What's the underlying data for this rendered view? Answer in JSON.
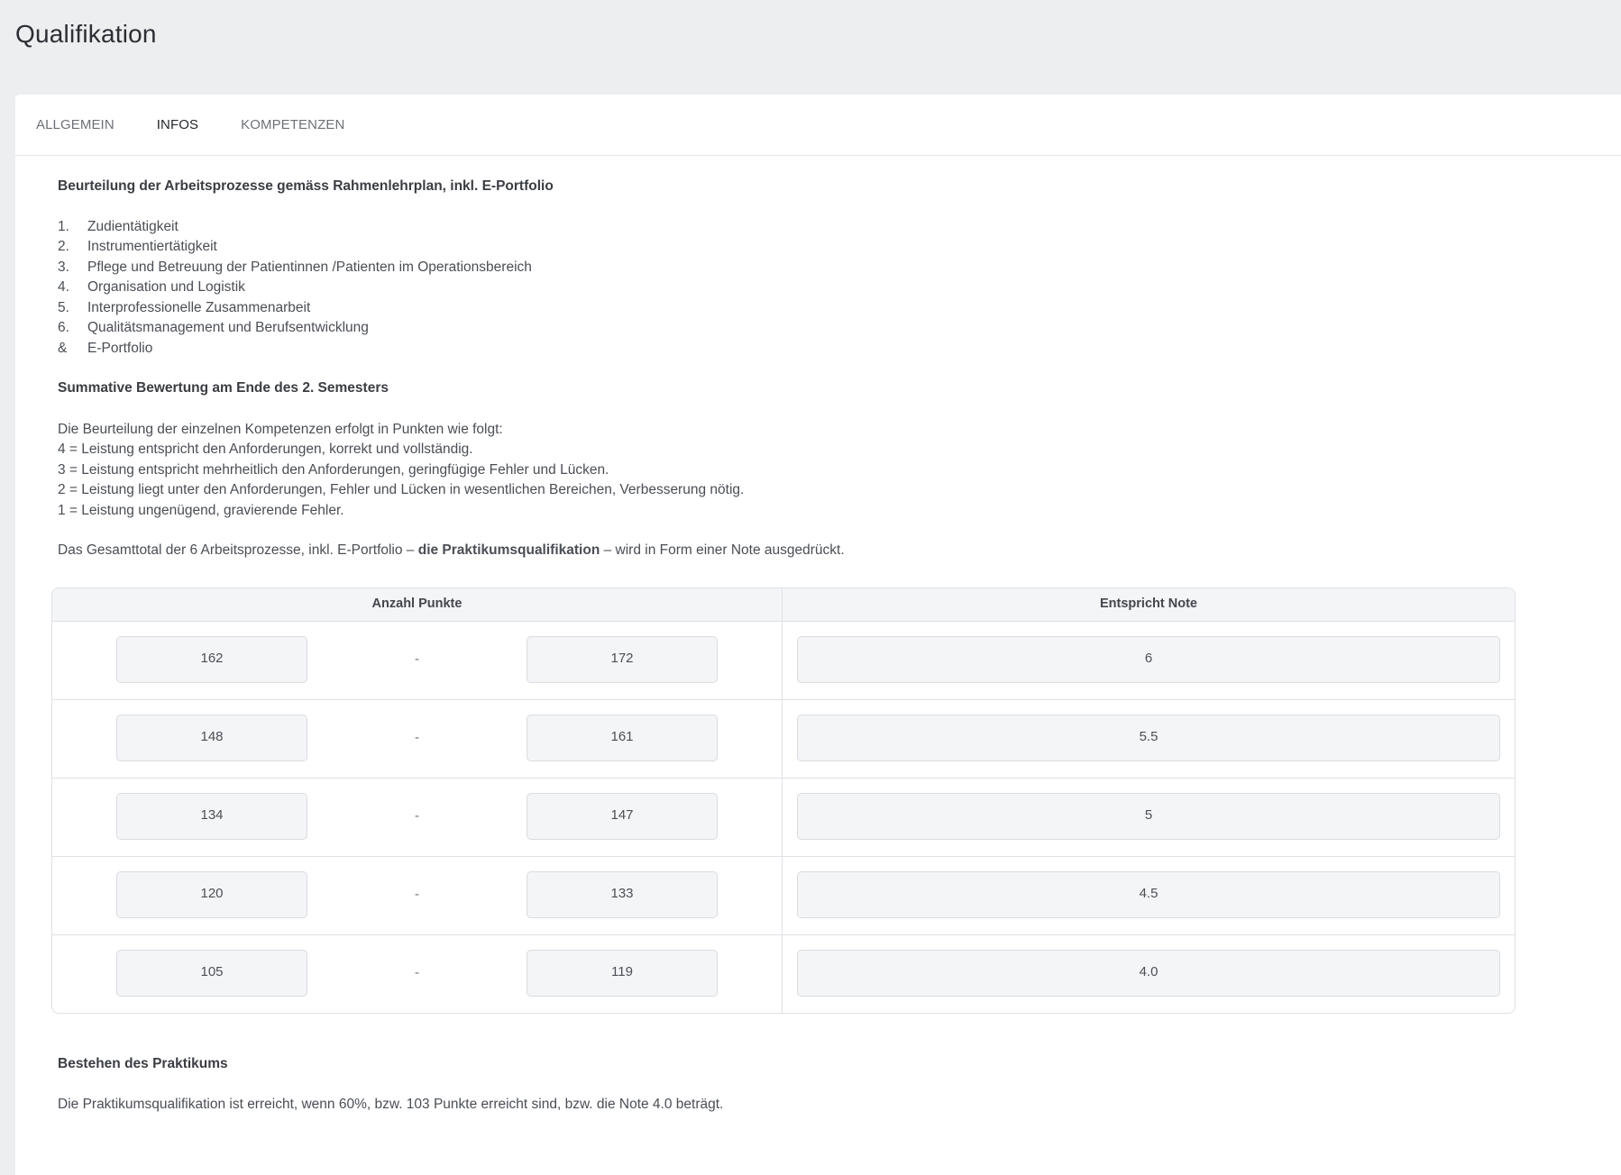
{
  "page": {
    "title": "Qualifikation"
  },
  "tabs": [
    {
      "label": "ALLGEMEIN",
      "active": false
    },
    {
      "label": "INFOS",
      "active": true
    },
    {
      "label": "KOMPETENZEN",
      "active": false
    }
  ],
  "assessment": {
    "heading": "Beurteilung der Arbeitsprozesse gemäss Rahmenlehrplan, inkl. E-Portfolio",
    "items": [
      {
        "num": "1.",
        "label": "Zudientätigkeit"
      },
      {
        "num": "2.",
        "label": "Instrumentiertätigkeit"
      },
      {
        "num": "3.",
        "label": "Pflege und Betreuung der Patientinnen /Patienten im Operationsbereich"
      },
      {
        "num": "4.",
        "label": "Organisation und Logistik"
      },
      {
        "num": "5.",
        "label": "Interprofessionelle Zusammenarbeit"
      },
      {
        "num": "6.",
        "label": "Qualitätsmanagement und Berufsentwicklung"
      },
      {
        "num": "&",
        "label": "E-Portfolio"
      }
    ]
  },
  "summative": {
    "heading": "Summative Bewertung am Ende des 2. Semesters",
    "intro": "Die Beurteilung der einzelnen Kompetenzen erfolgt in Punkten wie folgt:",
    "scale": [
      "4 = Leistung entspricht den Anforderungen, korrekt und vollständig.",
      "3 = Leistung entspricht mehrheitlich den Anforderungen, geringfügige Fehler und Lücken.",
      "2 = Leistung liegt unter den Anforderungen, Fehler und Lücken in wesentlichen Bereichen, Verbesserung nötig.",
      "1 = Leistung ungenügend, gravierende Fehler."
    ],
    "total_prefix": "Das Gesamttotal der 6 Arbeitsprozesse, inkl. E-Portfolio – ",
    "total_bold": "die Praktikumsqualifikation",
    "total_suffix": " – wird in Form einer Note ausgedrückt."
  },
  "grade_table": {
    "header_points": "Anzahl Punkte",
    "header_note": "Entspricht Note",
    "separator": "-",
    "rows": [
      {
        "from": "162",
        "to": "172",
        "note": "6"
      },
      {
        "from": "148",
        "to": "161",
        "note": "5.5"
      },
      {
        "from": "134",
        "to": "147",
        "note": "5"
      },
      {
        "from": "120",
        "to": "133",
        "note": "4.5"
      },
      {
        "from": "105",
        "to": "119",
        "note": "4.0"
      }
    ]
  },
  "passing": {
    "heading": "Bestehen des Praktikums",
    "text": "Die Praktikumsqualifikation ist erreicht, wenn 60%, bzw. 103 Punkte erreicht sind, bzw. die Note 4.0 beträgt."
  }
}
